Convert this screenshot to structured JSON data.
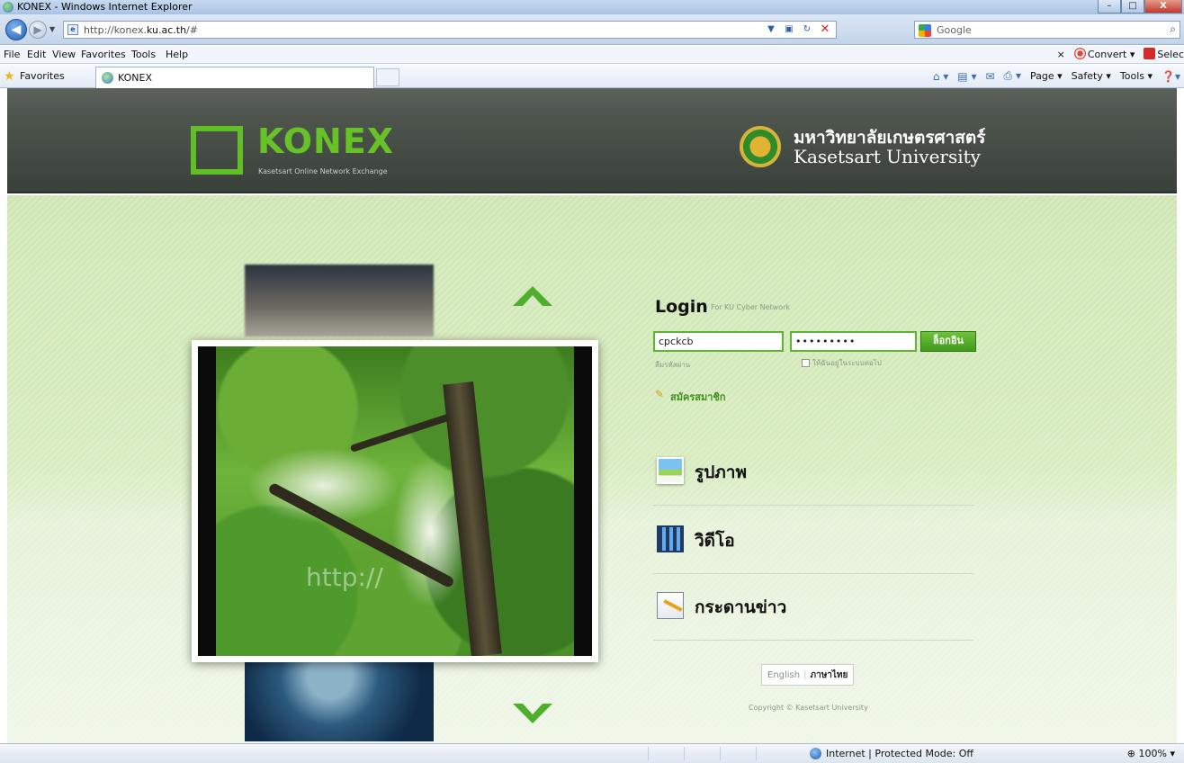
{
  "window": {
    "title": "KONEX - Windows Internet Explorer",
    "buttons": {
      "minimize": "–",
      "maximize": "□",
      "close": "X"
    }
  },
  "address_bar": {
    "url_prefix": "http://konex.",
    "url_domain": "ku.ac.th",
    "url_suffix": "/#",
    "search_placeholder": "Google",
    "search_engine": "Google"
  },
  "menu": {
    "items": [
      "File",
      "Edit",
      "View",
      "Favorites",
      "Tools",
      "Help"
    ],
    "close_x": "×",
    "convert_label": "Convert",
    "select_label": "Selec"
  },
  "favorites_bar": {
    "favorites_label": "Favorites",
    "tab_label": "KONEX",
    "commands": [
      "Page",
      "Safety",
      "Tools"
    ]
  },
  "site_header": {
    "logo_text": "KONEX",
    "logo_subtitle": "Kasetsart Online Network Exchange",
    "university_thai": "มหาวิทยาลัยเกษตรศาสตร์",
    "university_english": "Kasetsart University"
  },
  "carousel": {
    "watermark": "http://"
  },
  "login": {
    "title": "Login",
    "subtitle": "For KU Cyber Network",
    "username_value": "cpckcb",
    "password_value": "•••••••••",
    "submit_label": "ล็อกอิน",
    "forgot_label": "ลืมรหัสผ่าน",
    "remember_label": "ให้ฉันอยู่ในระบบต่อไป",
    "register_label": "สมัครสมาชิก"
  },
  "sections": [
    {
      "label": "รูปภาพ",
      "icon": "photo-icon"
    },
    {
      "label": "วิดีโอ",
      "icon": "video-icon"
    },
    {
      "label": "กระดานข่าว",
      "icon": "board-icon"
    }
  ],
  "footer": {
    "lang_english": "English",
    "lang_thai": "ภาษาไทย",
    "copyright": "Copyright © Kasetsart University"
  },
  "status_bar": {
    "zone_text": "Internet | Protected Mode: Off",
    "zoom": "100%"
  },
  "colors": {
    "brand_green": "#5fbf25",
    "header_dark": "#454c45",
    "content_green": "#d6ebc2"
  }
}
